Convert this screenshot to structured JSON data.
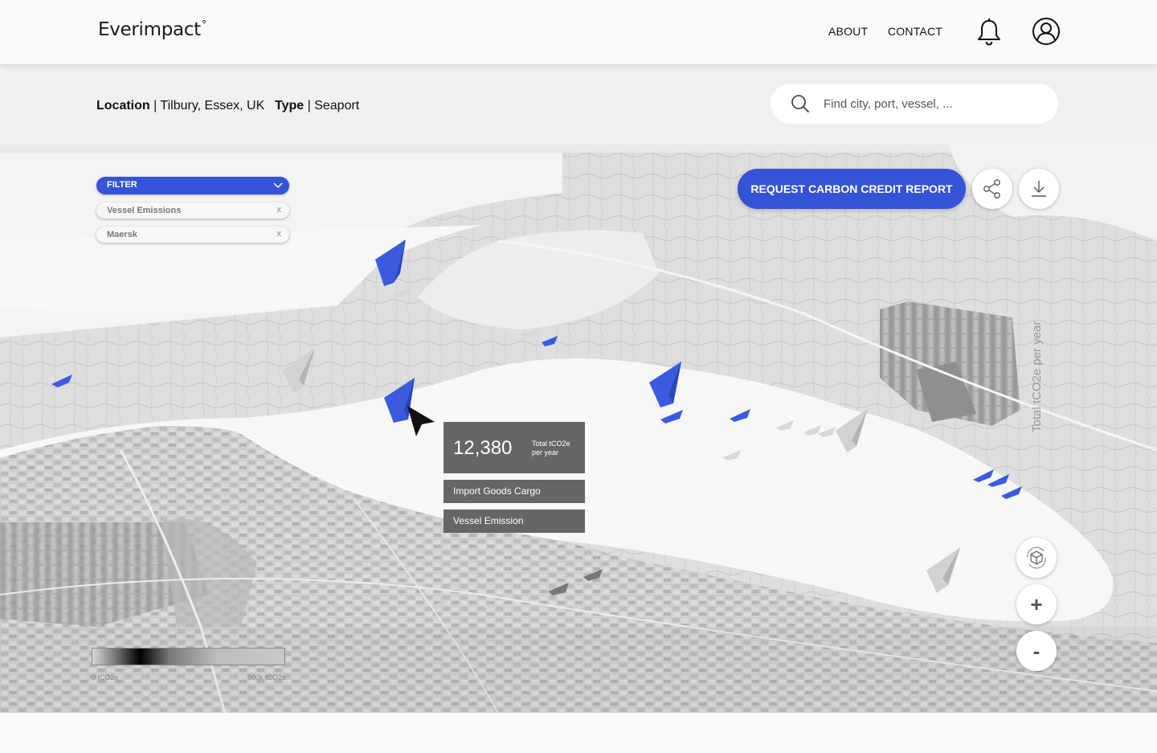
{
  "header": {
    "logo": "Everimpact",
    "logo_mark": "°",
    "nav": {
      "about": "ABOUT",
      "contact": "CONTACT"
    }
  },
  "info": {
    "location_label": "Location",
    "location_value": " | Tilbury, Essex, UK",
    "type_label": "Type",
    "type_value": " | Seaport"
  },
  "search": {
    "placeholder": "Find city, port, vessel, ..."
  },
  "filters": {
    "label": "FILTER",
    "chips": [
      {
        "label": "Vessel Emissions",
        "remove": "x"
      },
      {
        "label": "Maersk",
        "remove": "x"
      }
    ]
  },
  "actions": {
    "cta": "REQUEST CARBON CREDIT REPORT",
    "share_icon": "share-icon",
    "download_icon": "download-icon"
  },
  "tooltip": {
    "value": "12,380",
    "unit_line1": "Total tCO2e",
    "unit_line2": "per year",
    "rows": [
      "Import Goods Cargo",
      "Vessel Emission"
    ]
  },
  "legend": {
    "min": "0 tCO2e",
    "max": "500k tCO2e"
  },
  "map_axis_label": "Total tCO2e per year",
  "map_controls": {
    "zoom_in": "+",
    "zoom_out": "-",
    "view_3d_icon": "cube-rotate-icon"
  },
  "colors": {
    "accent": "#3553d6",
    "tooltip_bg": "#666666",
    "marker_blue": "#3a5be0",
    "marker_gray": "#c9c9c9"
  }
}
